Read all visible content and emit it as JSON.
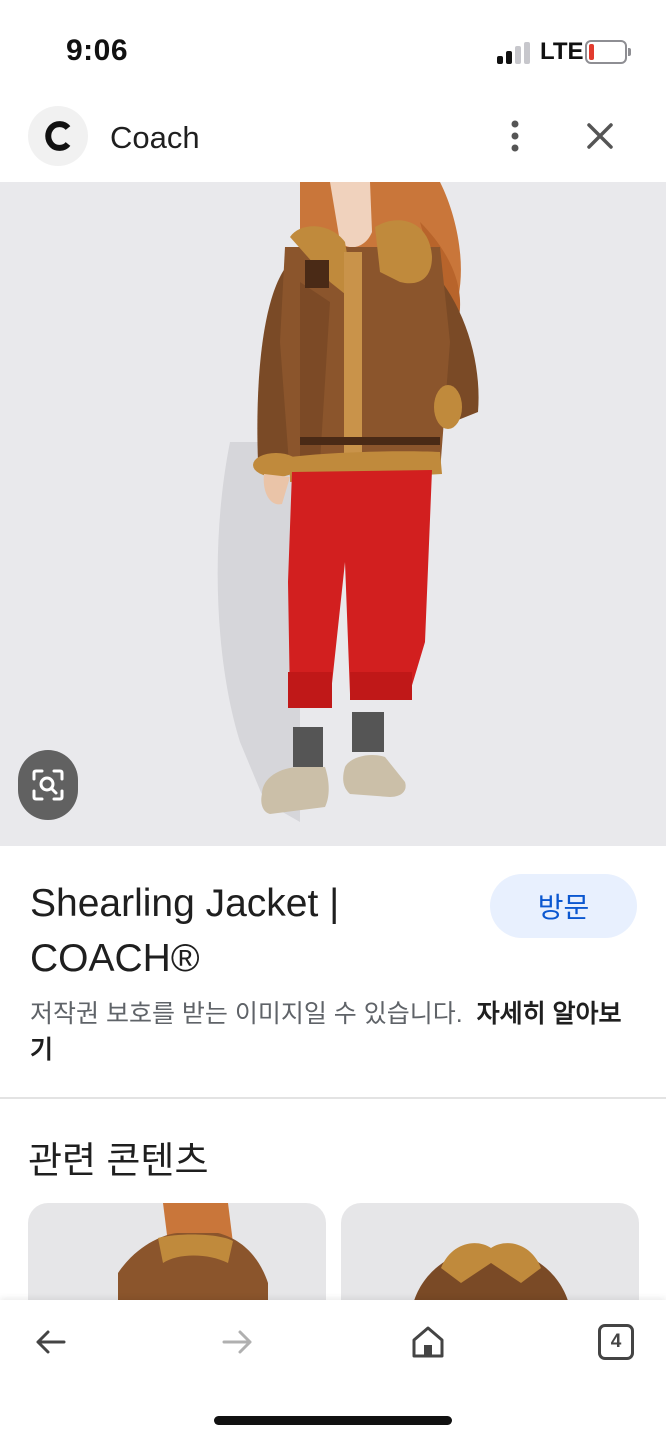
{
  "status": {
    "time": "9:06",
    "network": "LTE",
    "battery_color": "#e23b2e"
  },
  "header": {
    "site_name": "Coach",
    "logo_letter": "C"
  },
  "hero": {
    "image_alt": "Shearling Jacket"
  },
  "result": {
    "title": "Shearling Jacket | COACH®",
    "visit_label": "방문",
    "copyright_text": "저작권 보호를 받는 이미지일 수 있습니다.",
    "learn_more": "자세히 알아보기"
  },
  "related": {
    "title": "관련 콘텐츠"
  },
  "bottom_nav": {
    "tab_count": "4"
  },
  "colors": {
    "accent": "#0b57d0",
    "visit_bg": "#e8f0fe",
    "image_bg": "#e9e9ec"
  }
}
